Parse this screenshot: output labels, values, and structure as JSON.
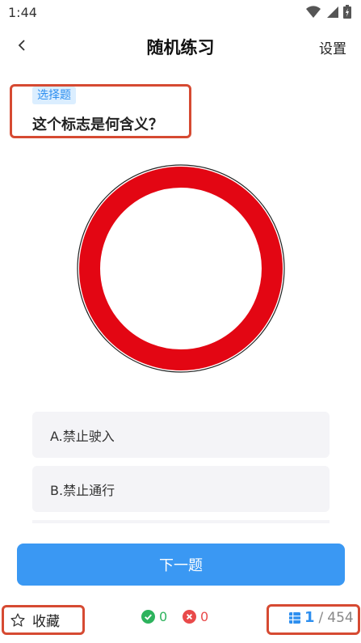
{
  "status_bar": {
    "time": "1:44"
  },
  "nav": {
    "title": "随机练习",
    "settings_label": "设置"
  },
  "question": {
    "type_tag": "选择题",
    "text": "这个标志是何含义？"
  },
  "sign": {
    "icon": "prohibition-sign-icon",
    "ring_color": "#e30613"
  },
  "options": [
    {
      "label": "A.禁止驶入"
    },
    {
      "label": "B.禁止通行"
    }
  ],
  "next_button": {
    "label": "下一题"
  },
  "bottom_bar": {
    "favorite_label": "收藏",
    "correct_count": "0",
    "wrong_count": "0",
    "current_index": "1",
    "separator": "/",
    "total": "454"
  },
  "colors": {
    "accent": "#3a98f3",
    "highlight_frame": "#d64a32",
    "correct": "#2db35d",
    "wrong": "#e94a4a"
  }
}
